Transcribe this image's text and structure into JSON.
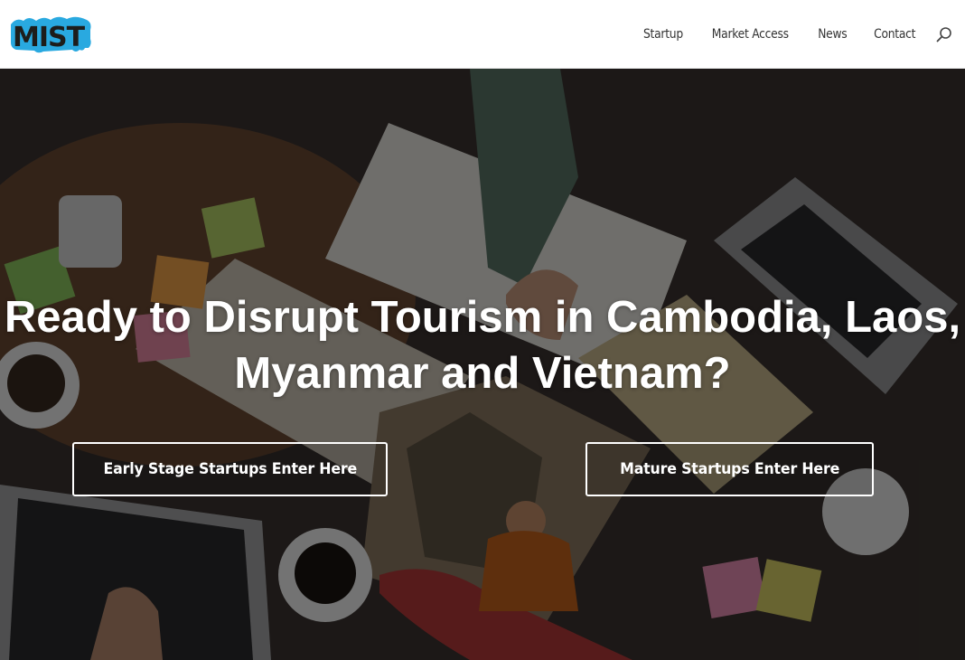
{
  "header": {
    "logo_text": "MIST",
    "nav": [
      {
        "label": "Startup"
      },
      {
        "label": "Market Access"
      },
      {
        "label": "News"
      },
      {
        "label": "Contact"
      }
    ],
    "search_icon": "search-icon"
  },
  "hero": {
    "headline_line1": "Ready to Disrupt Tourism in Cambodia, Laos,",
    "headline_line2": "Myanmar and Vietnam?",
    "buttons": [
      {
        "label": "Early Stage Startups Enter Here"
      },
      {
        "label": "Mature Startups Enter Here"
      }
    ]
  },
  "colors": {
    "logo_blue": "#29a9e0",
    "logo_dark": "#1d1d1b",
    "nav_text": "#333333",
    "overlay": "rgba(0,0,0,0.52)",
    "button_border": "#ffffff"
  }
}
